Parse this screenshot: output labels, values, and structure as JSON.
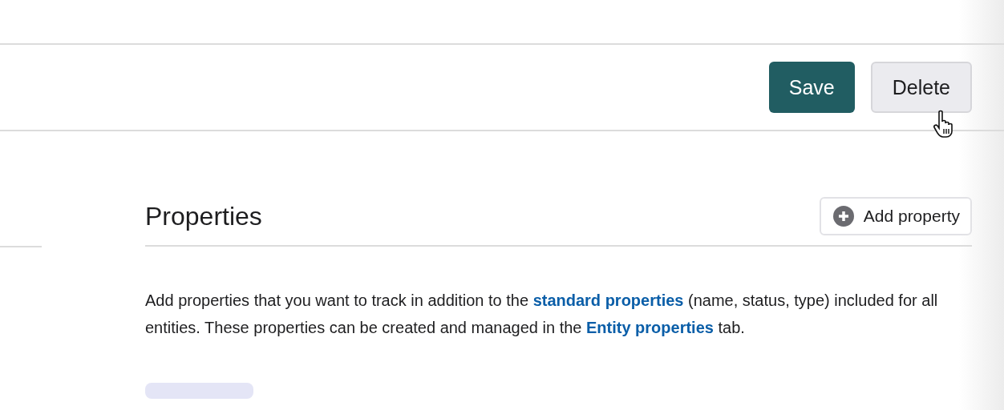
{
  "toolbar": {
    "buttons": [
      {
        "label": "Save",
        "kind": "primary"
      },
      {
        "label": "Delete",
        "kind": "secondary",
        "hovered": true
      }
    ]
  },
  "properties": {
    "title": "Properties",
    "add_button": {
      "label": "Add property"
    },
    "description": [
      {
        "kind": "text",
        "text": "Add properties that you want to track in addition to the "
      },
      {
        "kind": "link",
        "text": "standard properties"
      },
      {
        "kind": "text",
        "text": " (name, status, type) included for all entities. These properties can be created and managed in the "
      },
      {
        "kind": "link",
        "text": "Entity properties"
      },
      {
        "kind": "text",
        "text": " tab."
      }
    ]
  }
}
